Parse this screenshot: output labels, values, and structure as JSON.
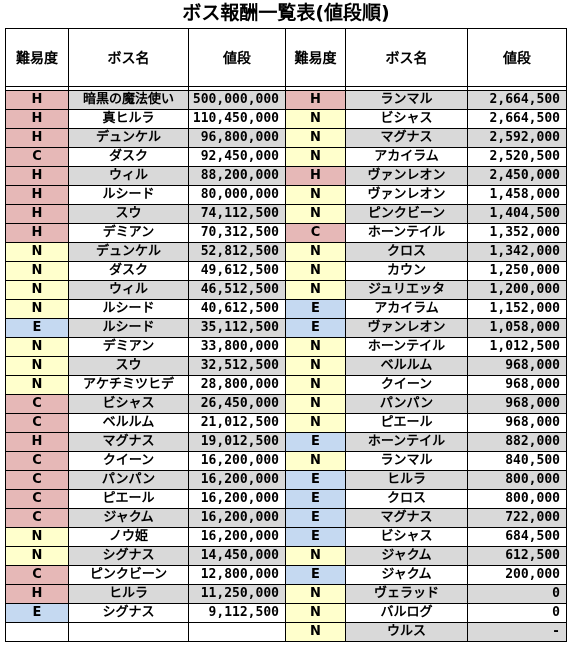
{
  "title": "ボス報酬一覧表(値段順)",
  "headers": {
    "difficulty": "難易度",
    "boss": "ボス名",
    "price": "値段"
  },
  "left": [
    {
      "d": "H",
      "name": "暗黒の魔法使い",
      "price": "500,000,000"
    },
    {
      "d": "H",
      "name": "真ヒルラ",
      "price": "110,450,000"
    },
    {
      "d": "H",
      "name": "デュンケル",
      "price": "96,800,000"
    },
    {
      "d": "C",
      "name": "ダスク",
      "price": "92,450,000"
    },
    {
      "d": "H",
      "name": "ウィル",
      "price": "88,200,000"
    },
    {
      "d": "H",
      "name": "ルシード",
      "price": "80,000,000"
    },
    {
      "d": "H",
      "name": "スウ",
      "price": "74,112,500"
    },
    {
      "d": "H",
      "name": "デミアン",
      "price": "70,312,500"
    },
    {
      "d": "N",
      "name": "デュンケル",
      "price": "52,812,500"
    },
    {
      "d": "N",
      "name": "ダスク",
      "price": "49,612,500"
    },
    {
      "d": "N",
      "name": "ウィル",
      "price": "46,512,500"
    },
    {
      "d": "N",
      "name": "ルシード",
      "price": "40,612,500"
    },
    {
      "d": "E",
      "name": "ルシード",
      "price": "35,112,500"
    },
    {
      "d": "N",
      "name": "デミアン",
      "price": "33,800,000"
    },
    {
      "d": "N",
      "name": "スウ",
      "price": "32,512,500"
    },
    {
      "d": "N",
      "name": "アケチミツヒデ",
      "price": "28,800,000"
    },
    {
      "d": "C",
      "name": "ビシャス",
      "price": "26,450,000"
    },
    {
      "d": "C",
      "name": "ベルルム",
      "price": "21,012,500"
    },
    {
      "d": "H",
      "name": "マグナス",
      "price": "19,012,500"
    },
    {
      "d": "C",
      "name": "クイーン",
      "price": "16,200,000"
    },
    {
      "d": "C",
      "name": "パンパン",
      "price": "16,200,000"
    },
    {
      "d": "C",
      "name": "ピエール",
      "price": "16,200,000"
    },
    {
      "d": "C",
      "name": "ジャクム",
      "price": "16,200,000"
    },
    {
      "d": "N",
      "name": "ノウ姫",
      "price": "16,200,000"
    },
    {
      "d": "N",
      "name": "シグナス",
      "price": "14,450,000"
    },
    {
      "d": "C",
      "name": "ピンクビーン",
      "price": "12,800,000"
    },
    {
      "d": "H",
      "name": "ヒルラ",
      "price": "11,250,000"
    },
    {
      "d": "E",
      "name": "シグナス",
      "price": "9,112,500"
    }
  ],
  "right": [
    {
      "d": "H",
      "name": "ランマル",
      "price": "2,664,500"
    },
    {
      "d": "N",
      "name": "ビシャス",
      "price": "2,664,500"
    },
    {
      "d": "N",
      "name": "マグナス",
      "price": "2,592,000"
    },
    {
      "d": "N",
      "name": "アカイラム",
      "price": "2,520,500"
    },
    {
      "d": "H",
      "name": "ヴァンレオン",
      "price": "2,450,000"
    },
    {
      "d": "N",
      "name": "ヴァンレオン",
      "price": "1,458,000"
    },
    {
      "d": "N",
      "name": "ピンクビーン",
      "price": "1,404,500"
    },
    {
      "d": "C",
      "name": "ホーンテイル",
      "price": "1,352,000"
    },
    {
      "d": "N",
      "name": "クロス",
      "price": "1,342,000"
    },
    {
      "d": "N",
      "name": "カウン",
      "price": "1,250,000"
    },
    {
      "d": "N",
      "name": "ジュリエッタ",
      "price": "1,200,000"
    },
    {
      "d": "E",
      "name": "アカイラム",
      "price": "1,152,000"
    },
    {
      "d": "E",
      "name": "ヴァンレオン",
      "price": "1,058,000"
    },
    {
      "d": "N",
      "name": "ホーンテイル",
      "price": "1,012,500"
    },
    {
      "d": "N",
      "name": "ベルルム",
      "price": "968,000"
    },
    {
      "d": "N",
      "name": "クイーン",
      "price": "968,000"
    },
    {
      "d": "N",
      "name": "パンパン",
      "price": "968,000"
    },
    {
      "d": "N",
      "name": "ピエール",
      "price": "968,000"
    },
    {
      "d": "E",
      "name": "ホーンテイル",
      "price": "882,000"
    },
    {
      "d": "N",
      "name": "ランマル",
      "price": "840,500"
    },
    {
      "d": "E",
      "name": "ヒルラ",
      "price": "800,000"
    },
    {
      "d": "E",
      "name": "クロス",
      "price": "800,000"
    },
    {
      "d": "E",
      "name": "マグナス",
      "price": "722,000"
    },
    {
      "d": "E",
      "name": "ビシャス",
      "price": "684,500"
    },
    {
      "d": "N",
      "name": "ジャクム",
      "price": "612,500"
    },
    {
      "d": "E",
      "name": "ジャクム",
      "price": "200,000"
    },
    {
      "d": "N",
      "name": "ヴェラッド",
      "price": "0"
    },
    {
      "d": "N",
      "name": "バルログ",
      "price": "0"
    },
    {
      "d": "N",
      "name": "ウルス",
      "price": "-"
    }
  ]
}
